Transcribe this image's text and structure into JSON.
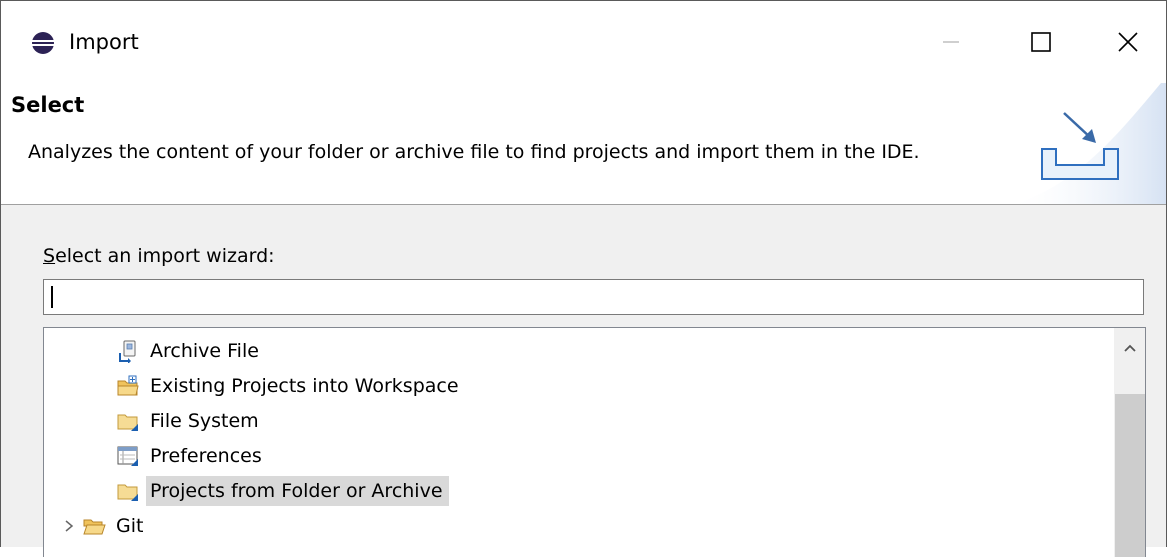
{
  "window": {
    "title": "Import",
    "icon": "eclipse-icon",
    "controls": {
      "minimize": "minimize-icon",
      "maximize": "maximize-icon",
      "close": "close-icon"
    }
  },
  "banner": {
    "title": "Select",
    "description": "Analyzes the content of your folder or archive file to find projects and import them in the IDE.",
    "icon": "import-wizard-icon"
  },
  "wizard": {
    "label": "Select an import wizard:",
    "label_mnemonic": "S",
    "label_rest": "elect an import wizard:",
    "filter_value": "",
    "items": [
      {
        "label": "Archive File",
        "icon": "archive-file-icon",
        "selected": false
      },
      {
        "label": "Existing Projects into Workspace",
        "icon": "existing-projects-icon",
        "selected": false
      },
      {
        "label": "File System",
        "icon": "folder-icon",
        "selected": false
      },
      {
        "label": "Preferences",
        "icon": "preferences-icon",
        "selected": false
      },
      {
        "label": "Projects from Folder or Archive",
        "icon": "folder-icon",
        "selected": true
      },
      {
        "label": "Git",
        "icon": "open-folder-icon",
        "selected": false,
        "collapsed": true
      }
    ]
  },
  "colors": {
    "selection": "#d9d9d9",
    "dialog_bg": "#f0f0f0",
    "folder": "#e8c468",
    "accent": "#1b5fb0"
  }
}
